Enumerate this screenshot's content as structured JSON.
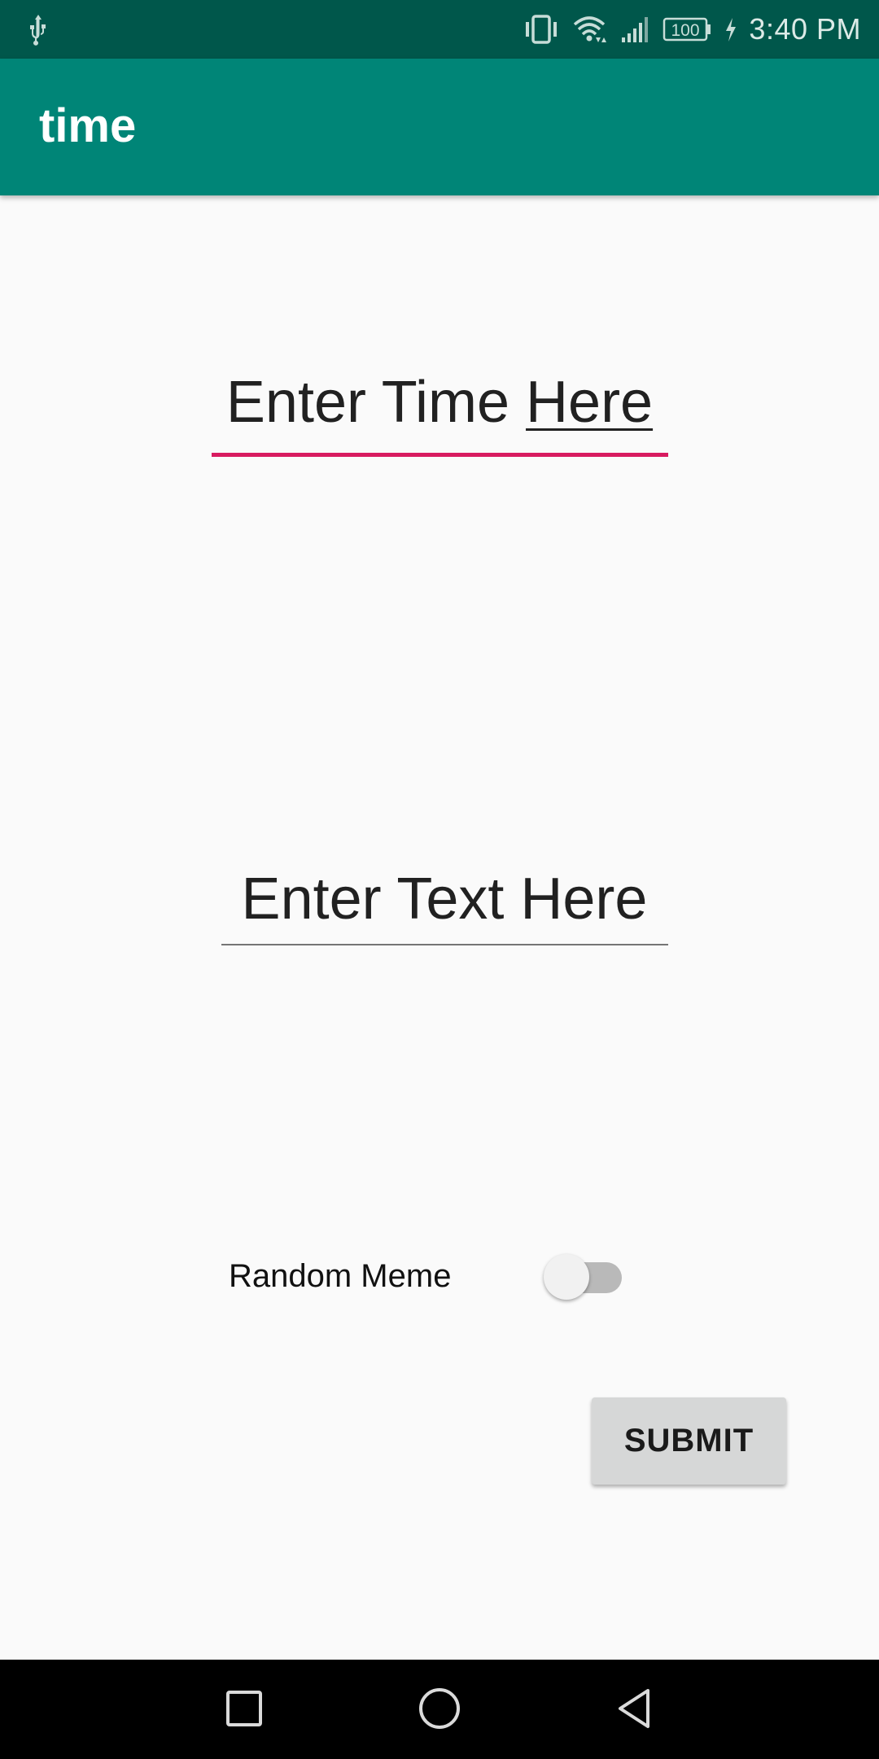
{
  "status_bar": {
    "time": "3:40 PM",
    "battery": "100",
    "icons": [
      "usb-icon",
      "vibrate-icon",
      "wifi-icon",
      "signal-icon",
      "battery-icon",
      "charging-icon"
    ]
  },
  "app_bar": {
    "title": "time"
  },
  "form": {
    "time_field": {
      "text_part1": "Enter Time ",
      "text_part2": "Here",
      "focused": true
    },
    "text_field": {
      "text": "Enter Text Here"
    },
    "random_meme": {
      "label": "Random Meme",
      "checked": false
    },
    "submit_label": "SUBMIT"
  },
  "nav_bar": {
    "icons": [
      "recents-icon",
      "home-icon",
      "back-icon"
    ]
  },
  "colors": {
    "status_bar": "#00574B",
    "app_bar": "#008577",
    "accent": "#D81B60",
    "background": "#FAFAFA"
  }
}
